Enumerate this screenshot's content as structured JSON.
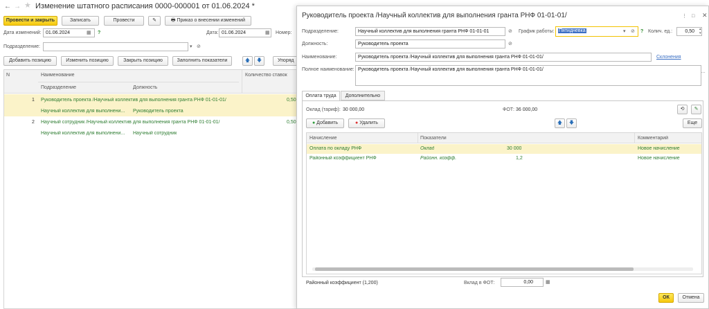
{
  "main": {
    "title": "Изменение штатного расписания 0000-000001 от 01.06.2024 *",
    "toolbar": {
      "post_close": "Провести и закрыть",
      "save": "Записать",
      "post": "Провести",
      "order": "Приказ о внесении изменений"
    },
    "date_label": "Дата изменений:",
    "date_value": "01.06.2024",
    "date2_label": "Дата:",
    "date2_value": "01.06.2024",
    "number_label": "Номер:",
    "dept_label": "Подразделение:",
    "dept_value": "",
    "actions": {
      "add": "Добавить позицию",
      "change": "Изменить позицию",
      "close": "Закрыть позицию",
      "fill": "Заполнить показатели",
      "order": "Упоряд"
    },
    "table": {
      "col_n": "N",
      "col_name": "Наименование",
      "col_qty": "Количество ставок",
      "sub_dept": "Подразделение",
      "sub_pos": "Должность",
      "rows": [
        {
          "n": "1",
          "name": "Руководитель проекта /Научный коллектив для выполнения гранта РНФ 01-01-01/",
          "qty": "0,50",
          "dept": "Научный коллектив для выполнени...",
          "pos": "Руководитель проекта"
        },
        {
          "n": "2",
          "name": "Научный сотрудник /Научный коллектив для выполнения гранта РНФ 01-01-01/",
          "qty": "0,50",
          "dept": "Научный коллектив для выполнени...",
          "pos": "Научный сотрудник"
        }
      ]
    }
  },
  "dialog": {
    "title": "Руководитель проекта /Научный коллектив для выполнения гранта РНФ 01-01-01/",
    "dept_label": "Подразделение:",
    "dept_value": "Научный коллектив для выполнения гранта РНФ 01-01-01",
    "schedule_label": "График работы:",
    "schedule_value": "Пятидневка",
    "qty_label": "Колич. ед.:",
    "qty_value": "0,50",
    "position_label": "Должность:",
    "position_value": "Руководитель проекта",
    "name_label": "Наименование:",
    "name_value": "Руководитель проекта /Научный коллектив для выполнения гранта РНФ 01-01-01/",
    "declension": "Склонения",
    "fullname_label": "Полное наименование:",
    "fullname_value": "Руководитель проекта /Научный коллектив для выполнения гранта РНФ 01-01-01/",
    "tabs": [
      "Оплата труда",
      "Дополнительно"
    ],
    "salary_label": "Оклад (тариф):",
    "salary_value": "30 000,00",
    "fot_label": "ФОТ:",
    "fot_value": "36 000,00",
    "add_btn": "Добавить",
    "del_btn": "Удалить",
    "more_btn": "Еще",
    "grid": {
      "col_accrual": "Начисление",
      "col_indicators": "Показатели",
      "col_comment": "Комментарий",
      "rows": [
        {
          "accrual": "Оплата по окладу РНФ",
          "indicator": "Оклад",
          "value": "30 000",
          "comment": "Новое начисление"
        },
        {
          "accrual": "Районный коэффициент РНФ",
          "indicator": "Районн. коэфф.",
          "value": "1,2",
          "comment": "Новое начисление"
        }
      ]
    },
    "regional_label": "Районный коэффициент (1,200)",
    "contrib_label": "Вклад в ФОТ:",
    "contrib_value": "0,00",
    "ok": "ОК",
    "cancel": "Отмена"
  },
  "colors": {
    "accent": "#f6c80e",
    "row_highlight": "#fbf3c9",
    "green_text": "#2e7d32"
  }
}
